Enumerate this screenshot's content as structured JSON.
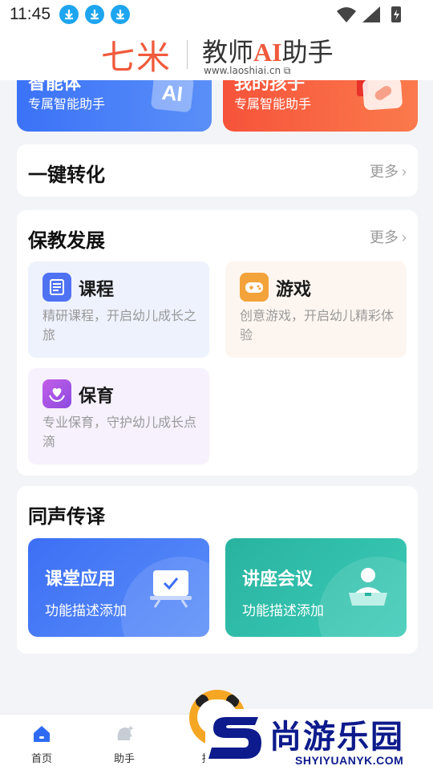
{
  "status_bar": {
    "time": "11:45",
    "download_icons": 3
  },
  "header": {
    "logo_left": "七米",
    "logo_right_prefix": "教师",
    "logo_right_ai": "AI",
    "logo_right_suffix": "助手",
    "url": "www.laoshiai.cn"
  },
  "top_cards": [
    {
      "title_partial": "智能体",
      "subtitle": "专属智能助手",
      "color": "#3b72f7",
      "icon": "ai-tile-icon"
    },
    {
      "title_partial": "我的孩子",
      "subtitle": "专属智能助手",
      "color": "#f6533a",
      "icon": "tag-icon"
    }
  ],
  "one_click": {
    "title": "一键转化",
    "more": "更多"
  },
  "childcare": {
    "title": "保教发展",
    "more": "更多",
    "items": [
      {
        "title": "课程",
        "desc": "精研课程，开启幼儿成长之旅",
        "icon": "course-icon",
        "icon_color": "#4f72f3",
        "bg": "#eef2fd"
      },
      {
        "title": "游戏",
        "desc": "创意游戏，开启幼儿精彩体验",
        "icon": "gamepad-icon",
        "icon_color": "#f3a33a",
        "bg": "#fdf6f0"
      },
      {
        "title": "保育",
        "desc": "专业保育，守护幼儿成长点滴",
        "icon": "care-icon",
        "icon_color": "#a855e8",
        "bg": "#f6f1fd"
      }
    ]
  },
  "interpretation": {
    "title": "同声传译",
    "cards": [
      {
        "title": "课堂应用",
        "desc": "功能描述添加",
        "icon": "classroom-board-icon",
        "color": "#3d6ff5"
      },
      {
        "title": "讲座会议",
        "desc": "功能描述添加",
        "icon": "lecture-speaker-icon",
        "color": "#28b3a0"
      }
    ]
  },
  "tab_bar": {
    "tabs": [
      {
        "label": "首页",
        "icon": "home-icon",
        "active": true
      },
      {
        "label": "助手",
        "icon": "assistant-icon",
        "active": false
      },
      {
        "label": "找",
        "icon": "mascot-icon",
        "active": false
      }
    ]
  },
  "watermark": {
    "brand_cn": "尚游乐园",
    "brand_en": "SHYIYUANYK.COM"
  }
}
